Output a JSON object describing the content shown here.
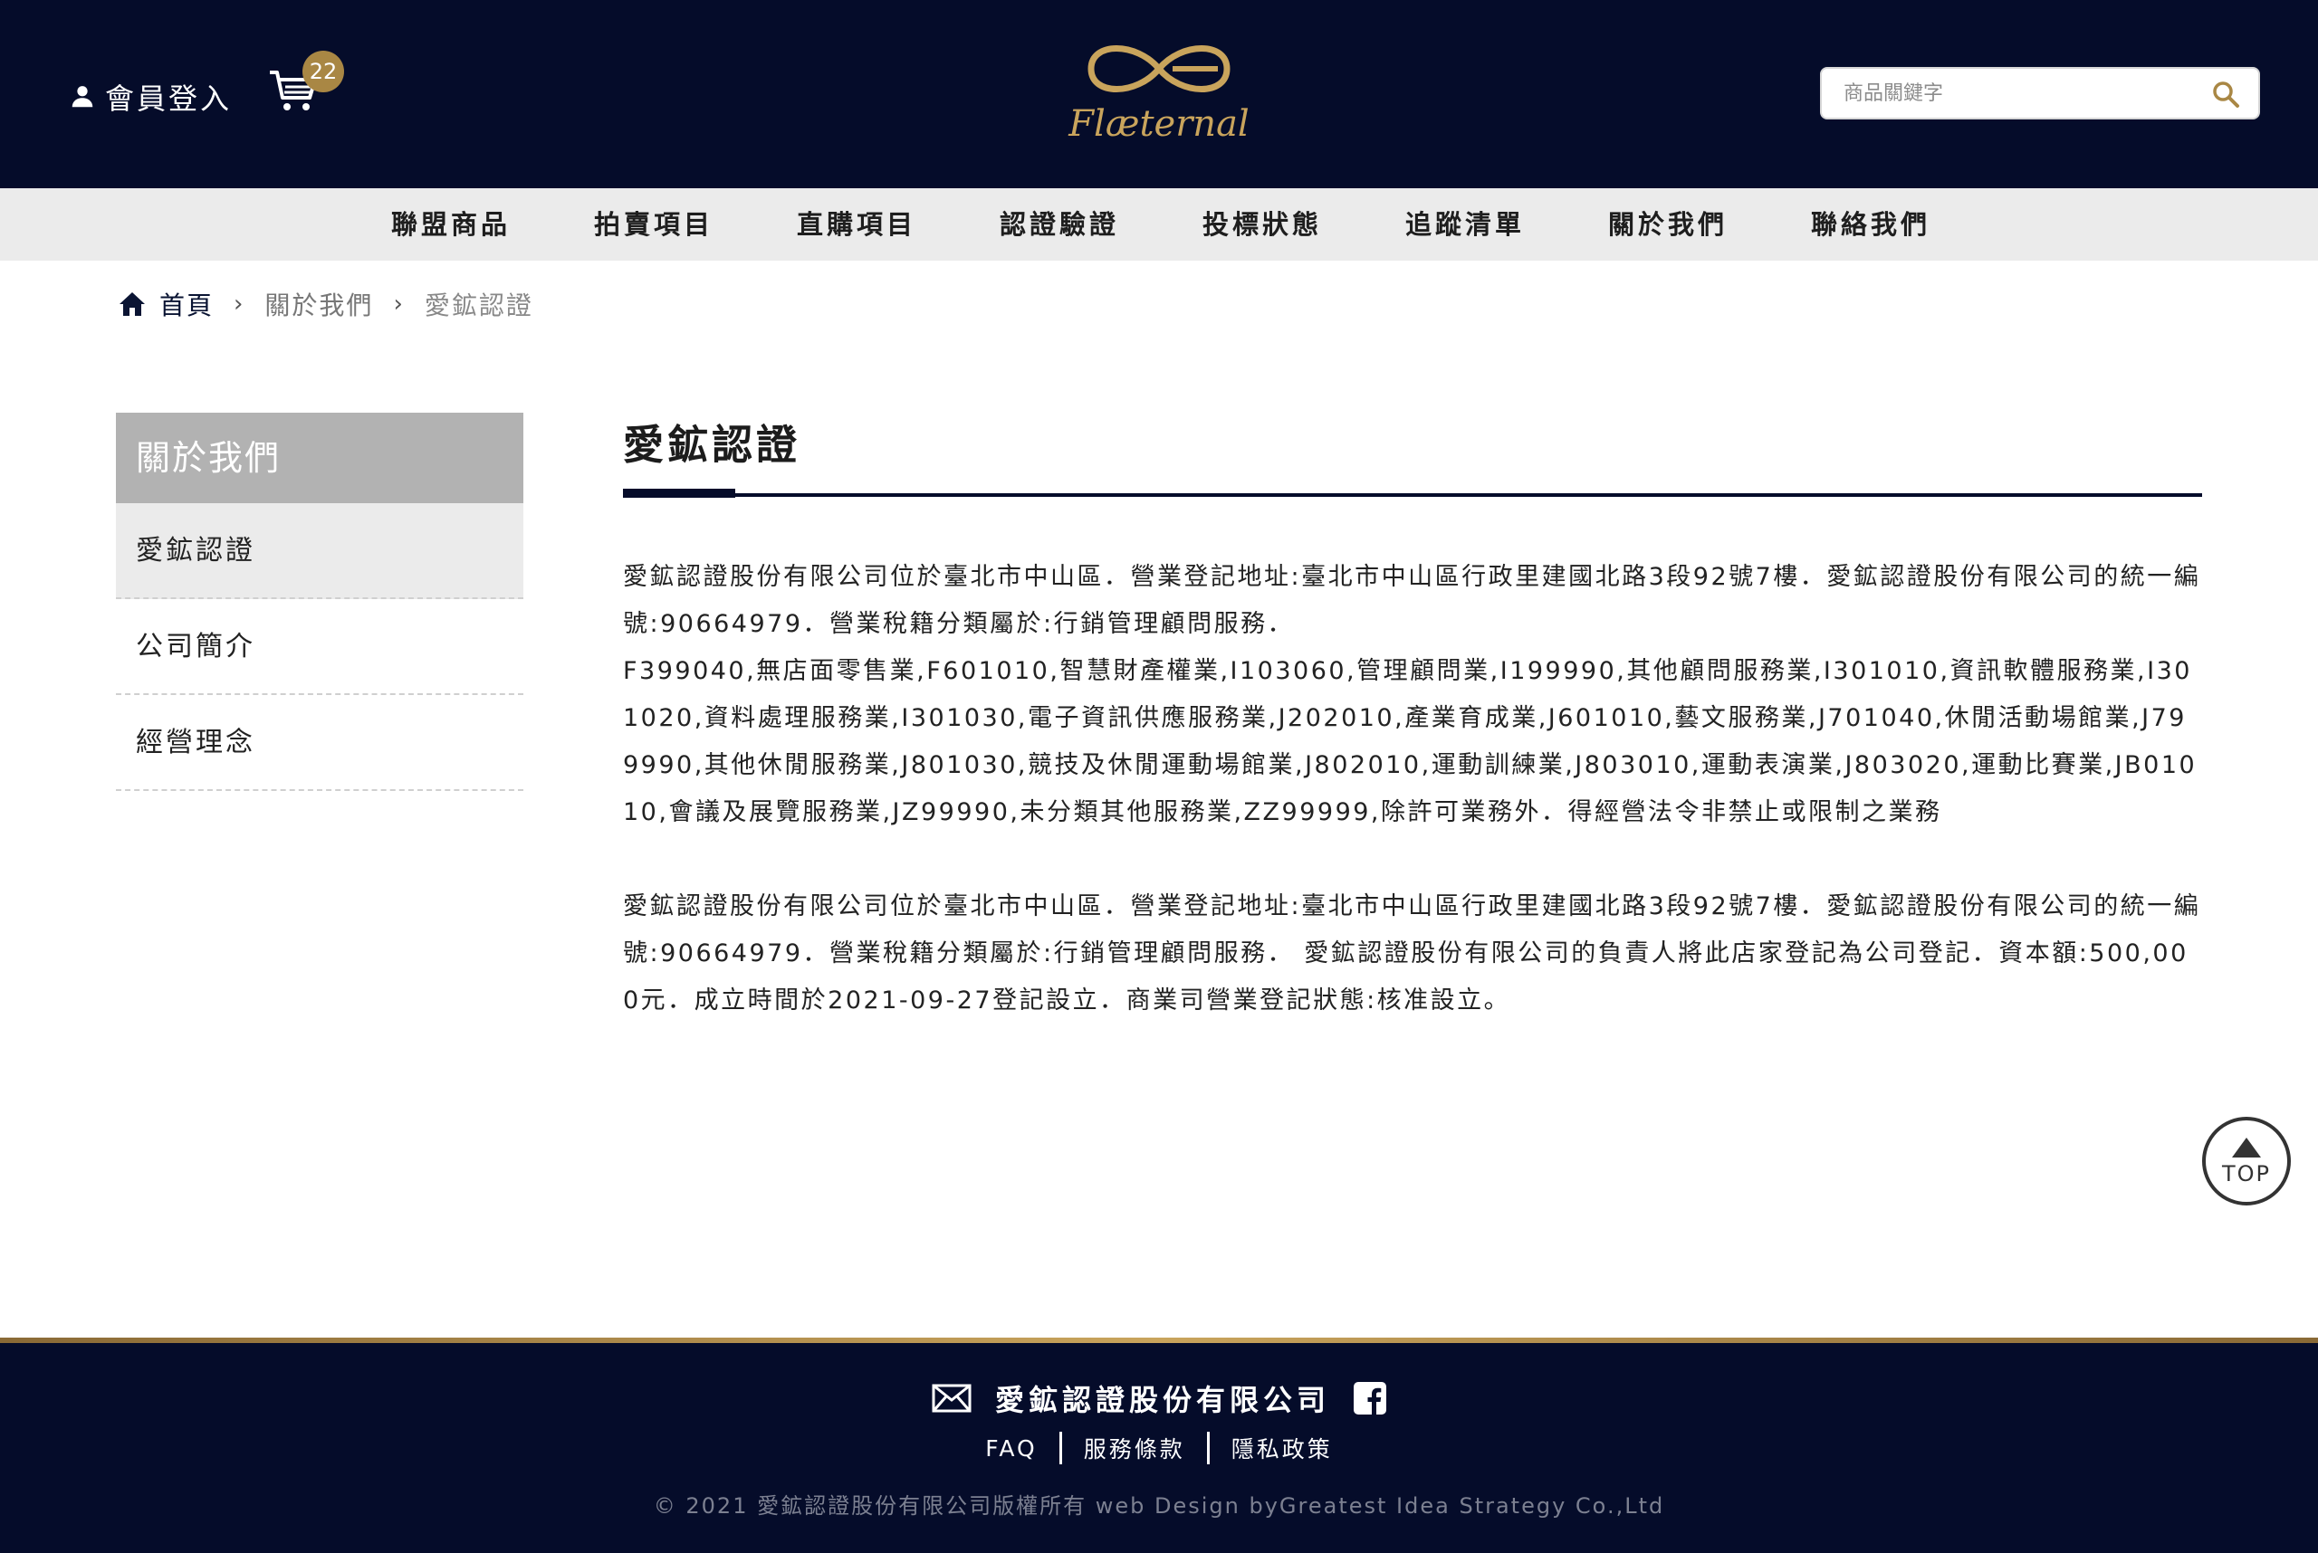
{
  "header": {
    "member_label": "會員登入",
    "cart_count": "22",
    "logo_text": "Flæternal",
    "search_placeholder": "商品關鍵字"
  },
  "nav": {
    "items": [
      {
        "label": "聯盟商品"
      },
      {
        "label": "拍賣項目"
      },
      {
        "label": "直購項目"
      },
      {
        "label": "認證驗證"
      },
      {
        "label": "投標狀態"
      },
      {
        "label": "追蹤清單"
      },
      {
        "label": "關於我們"
      },
      {
        "label": "聯絡我們"
      }
    ]
  },
  "breadcrumb": {
    "home": "首頁",
    "parent": "關於我們",
    "current": "愛鉱認證",
    "separator": "›"
  },
  "sidebar": {
    "title": "關於我們",
    "items": [
      {
        "label": "愛鉱認證"
      },
      {
        "label": "公司簡介"
      },
      {
        "label": "經營理念"
      }
    ]
  },
  "main": {
    "title": "愛鉱認證",
    "paragraph1": "愛鉱認證股份有限公司位於臺北市中山區．營業登記地址:臺北市中山區行政里建國北路3段92號7樓．愛鉱認證股份有限公司的統一編號:90664979．營業稅籍分類屬於:行銷管理顧問服務．",
    "paragraph1b": "F399040,無店面零售業,F601010,智慧財產權業,I103060,管理顧問業,I199990,其他顧問服務業,I301010,資訊軟體服務業,I301020,資料處理服務業,I301030,電子資訊供應服務業,J202010,產業育成業,J601010,藝文服務業,J701040,休閒活動場館業,J799990,其他休閒服務業,J801030,競技及休閒運動場館業,J802010,運動訓練業,J803010,運動表演業,J803020,運動比賽業,JB01010,會議及展覽服務業,JZ99990,未分類其他服務業,ZZ99999,除許可業務外．得經營法令非禁止或限制之業務",
    "paragraph2": "愛鉱認證股份有限公司位於臺北市中山區．營業登記地址:臺北市中山區行政里建國北路3段92號7樓．愛鉱認證股份有限公司的統一編號:90664979．營業稅籍分類屬於:行銷管理顧問服務．  愛鉱認證股份有限公司的負責人將此店家登記為公司登記．資本額:500,000元．成立時間於2021-09-27登記設立．商業司營業登記狀態:核准設立。"
  },
  "top_button": {
    "label": "TOP"
  },
  "footer": {
    "company": "愛鉱認證股份有限公司",
    "links": [
      {
        "label": "FAQ"
      },
      {
        "label": "服務條款"
      },
      {
        "label": "隱私政策"
      }
    ],
    "copyright": "© 2021 愛鉱認證股份有限公司版權所有 web Design byGreatest Idea Strategy Co.,Ltd"
  },
  "colors": {
    "header_bg": "#050c2a",
    "accent_gold": "#a98744",
    "nav_bg": "#ebebeb",
    "sidebar_head_bg": "#b2b2b2"
  },
  "icons": [
    "user-icon",
    "cart-icon",
    "search-icon",
    "home-icon",
    "chevron-right-icon",
    "mail-icon",
    "facebook-icon",
    "arrow-up-icon"
  ]
}
